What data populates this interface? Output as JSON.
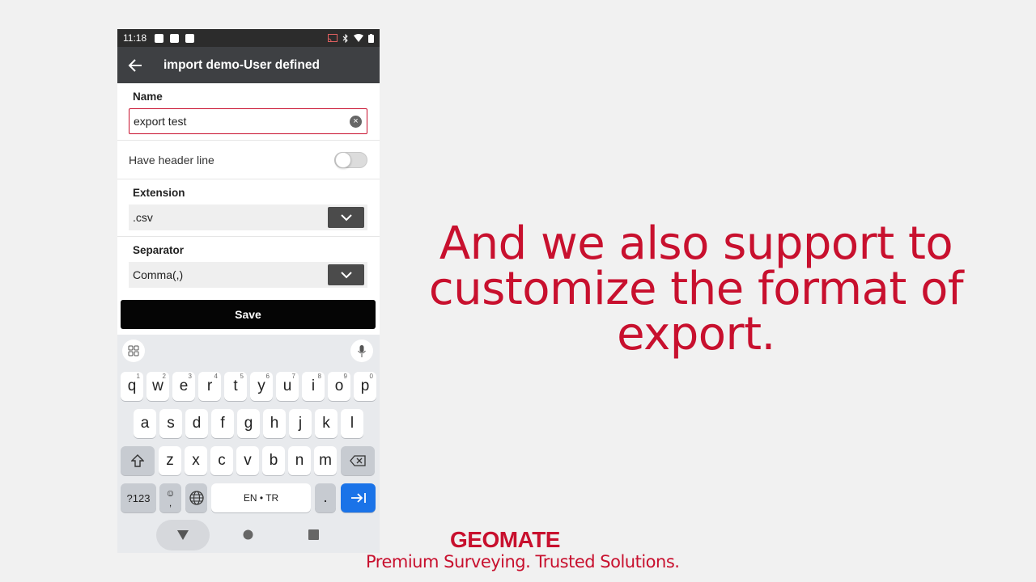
{
  "status_bar": {
    "time": "11:18"
  },
  "app_bar": {
    "title": "import demo-User defined"
  },
  "form": {
    "name_label": "Name",
    "name_value": "export test",
    "header_line_label": "Have header line",
    "header_line_on": false,
    "extension_label": "Extension",
    "extension_value": ".csv",
    "separator_label": "Separator",
    "separator_value": "Comma(,)",
    "save_label": "Save"
  },
  "keyboard": {
    "row1": [
      "q",
      "w",
      "e",
      "r",
      "t",
      "y",
      "u",
      "i",
      "o",
      "p"
    ],
    "row1_sup": [
      "1",
      "2",
      "3",
      "4",
      "5",
      "6",
      "7",
      "8",
      "9",
      "0"
    ],
    "row2": [
      "a",
      "s",
      "d",
      "f",
      "g",
      "h",
      "j",
      "k",
      "l"
    ],
    "row3": [
      "z",
      "x",
      "c",
      "v",
      "b",
      "n",
      "m"
    ],
    "symbols_label": "?123",
    "comma_label": ",",
    "emoji_label": "☺",
    "space_label": "EN • TR",
    "period_label": ".",
    "accent_color": "#1a73e8"
  },
  "overlay": {
    "headline_line1": "And we also support to",
    "headline_line2": "customize the format of",
    "headline_line3": "export.",
    "logo": "GEOMATE",
    "tagline": "Premium Surveying. Trusted Solutions.",
    "brand_color": "#c8102e"
  }
}
